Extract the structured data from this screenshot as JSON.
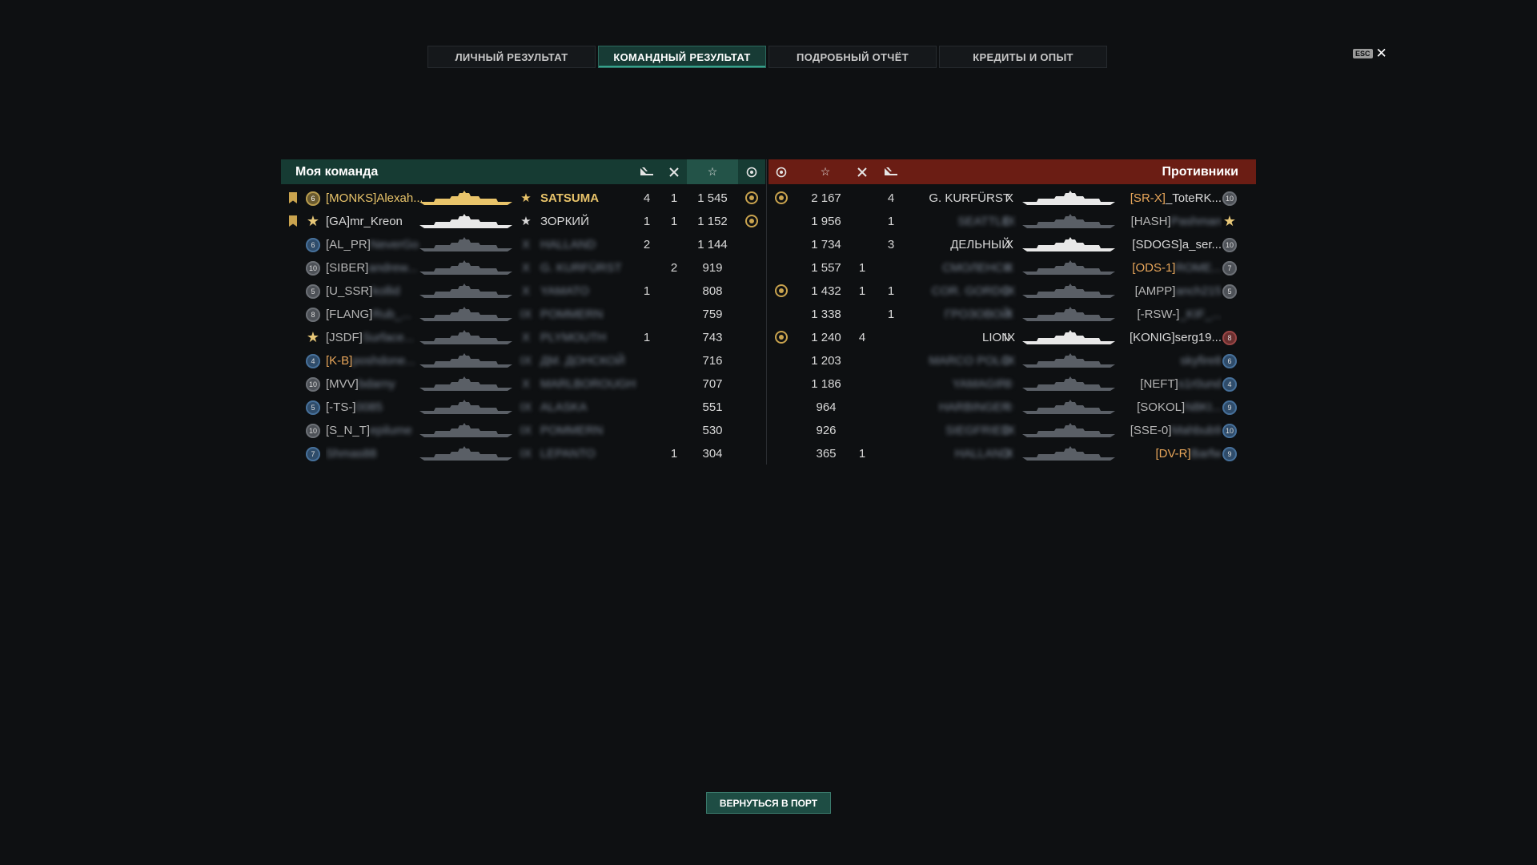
{
  "tabs": [
    {
      "label": "ЛИЧНЫЙ РЕЗУЛЬТАТ",
      "active": false
    },
    {
      "label": "КОМАНДНЫЙ РЕЗУЛЬТАТ",
      "active": true
    },
    {
      "label": "ПОДРОБНЫЙ ОТЧЁТ",
      "active": false
    },
    {
      "label": "КРЕДИТЫ И ОПЫТ",
      "active": false
    }
  ],
  "esc": {
    "key": "ESC",
    "close": "✕"
  },
  "my_team": {
    "title": "Моя команда",
    "header_icons": [
      "ship-sunk-icon",
      "planes-destroyed-icon",
      "base-xp-star-icon",
      "capture-icon"
    ],
    "rows": [
      {
        "tier": "6",
        "badge": "tier",
        "division": true,
        "clan": "[MONKS]",
        "name": "Alexah...",
        "tier_roman": "★",
        "ship": "SATSUMA",
        "kills": "4",
        "planes": "1",
        "xp": "1 545",
        "medal": true,
        "style": "gold"
      },
      {
        "tier": "★",
        "badge": "star",
        "division": true,
        "clan": "[GA]",
        "name": "mr_Kreon",
        "tier_roman": "★",
        "ship": "ЗОРКИЙ",
        "kills": "1",
        "planes": "1",
        "xp": "1 152",
        "medal": true,
        "style": "normal"
      },
      {
        "tier": "6",
        "badge": "blue",
        "division": false,
        "clan": "[AL_PR]",
        "name": "NeverGo",
        "tier_roman": "X",
        "ship": "HALLAND",
        "kills": "2",
        "planes": "",
        "xp": "1 144",
        "medal": false,
        "style": "dead"
      },
      {
        "tier": "10",
        "badge": "tier",
        "division": false,
        "clan": "[SIBER]",
        "name": "andrew...",
        "tier_roman": "X",
        "ship": "G. KURFÜRST",
        "kills": "",
        "planes": "2",
        "xp": "919",
        "medal": false,
        "style": "dead"
      },
      {
        "tier": "5",
        "badge": "tier",
        "division": false,
        "clan": "[U_SSR]",
        "name": "kollid",
        "tier_roman": "X",
        "ship": "YAMATO",
        "kills": "1",
        "planes": "",
        "xp": "808",
        "medal": false,
        "style": "dead"
      },
      {
        "tier": "8",
        "badge": "tier",
        "division": false,
        "clan": "[FLANG]",
        "name": "Rub_...",
        "tier_roman": "IX",
        "ship": "POMMERN",
        "kills": "",
        "planes": "",
        "xp": "759",
        "medal": false,
        "style": "dead"
      },
      {
        "tier": "★",
        "badge": "star",
        "division": false,
        "clan": "[JSDF]",
        "name": "Surface...",
        "tier_roman": "X",
        "ship": "PLYMOUTH",
        "kills": "1",
        "planes": "",
        "xp": "743",
        "medal": false,
        "style": "dead"
      },
      {
        "tier": "4",
        "badge": "blue",
        "division": false,
        "clan": "[K-B]",
        "name": "poshdone...",
        "tier_roman": "IX",
        "ship": "ДМ. ДОНСКОЙ",
        "kills": "",
        "planes": "",
        "xp": "716",
        "medal": false,
        "style": "dead-orange"
      },
      {
        "tier": "10",
        "badge": "tier",
        "division": false,
        "clan": "[MVV]",
        "name": "bdarny",
        "tier_roman": "X",
        "ship": "MARLBOROUGH",
        "kills": "",
        "planes": "",
        "xp": "707",
        "medal": false,
        "style": "dead"
      },
      {
        "tier": "5",
        "badge": "blue",
        "division": false,
        "clan": "[-TS-]",
        "name": "0085",
        "tier_roman": "IX",
        "ship": "ALASKA",
        "kills": "",
        "planes": "",
        "xp": "551",
        "medal": false,
        "style": "dead"
      },
      {
        "tier": "10",
        "badge": "tier",
        "division": false,
        "clan": "[S_N_T]",
        "name": "epilume",
        "tier_roman": "IX",
        "ship": "POMMERN",
        "kills": "",
        "planes": "",
        "xp": "530",
        "medal": false,
        "style": "dead"
      },
      {
        "tier": "7",
        "badge": "blue",
        "division": false,
        "clan": "",
        "name": "Shmas88",
        "tier_roman": "IX",
        "ship": "LEPANTO",
        "kills": "",
        "planes": "1",
        "xp": "304",
        "medal": false,
        "style": "dead"
      }
    ]
  },
  "enemy_team": {
    "title": "Противники",
    "header_icons": [
      "capture-icon",
      "base-xp-star-icon",
      "planes-destroyed-icon",
      "ship-sunk-icon"
    ],
    "rows": [
      {
        "medal": true,
        "xp": "2 167",
        "planes": "",
        "kills": "4",
        "ship": "G. KURFÜRST",
        "tier_roman": "X",
        "clan": "[SR-X]",
        "name": "_ToteRK...",
        "tier": "10",
        "badge": "tier",
        "style": "alive-orange"
      },
      {
        "medal": false,
        "xp": "1 956",
        "planes": "",
        "kills": "1",
        "ship": "SEATTLE",
        "tier_roman": "IX",
        "clan": "[HASH]",
        "name": "Pashman",
        "tier": "★",
        "badge": "star",
        "style": "dead"
      },
      {
        "medal": false,
        "xp": "1 734",
        "planes": "",
        "kills": "3",
        "ship": "ДЕЛЬНЫЙ",
        "tier_roman": "X",
        "clan": "[SDOGS]",
        "name": "a_ser...",
        "tier": "10",
        "badge": "tier",
        "style": "normal"
      },
      {
        "medal": false,
        "xp": "1 557",
        "planes": "1",
        "kills": "",
        "ship": "СМОЛЕНСК",
        "tier_roman": "X",
        "clan": "[ODS-1]",
        "name": "ROME...",
        "tier": "7",
        "badge": "tier",
        "style": "dead-orange"
      },
      {
        "medal": true,
        "xp": "1 432",
        "planes": "1",
        "kills": "1",
        "ship": "COR. GORDO",
        "tier_roman": "IX",
        "clan": "[AMPP]",
        "name": "anch215",
        "tier": "5",
        "badge": "tier",
        "style": "dead"
      },
      {
        "medal": false,
        "xp": "1 338",
        "planes": "",
        "kills": "1",
        "ship": "ГРОЗОВОЙ",
        "tier_roman": "X",
        "clan": "[-RSW-]",
        "name": "_KIF_...",
        "tier": "",
        "badge": "none",
        "style": "dead"
      },
      {
        "medal": true,
        "xp": "1 240",
        "planes": "4",
        "kills": "",
        "ship": "LION",
        "tier_roman": "IX",
        "clan": "[KONIG]",
        "name": "serg19...",
        "tier": "8",
        "badge": "red",
        "style": "normal"
      },
      {
        "medal": false,
        "xp": "1 203",
        "planes": "",
        "kills": "",
        "ship": "MARCO POLO",
        "tier_roman": "IX",
        "clan": "",
        "name": "skyfire8",
        "tier": "6",
        "badge": "blue",
        "style": "dead"
      },
      {
        "medal": false,
        "xp": "1 186",
        "planes": "",
        "kills": "",
        "ship": "YAMAGIRI",
        "tier_roman": "☆",
        "clan": "[NEFT]",
        "name": "s1r0und",
        "tier": "4",
        "badge": "blue",
        "style": "dead"
      },
      {
        "medal": false,
        "xp": "964",
        "planes": "",
        "kills": "",
        "ship": "HARBINGER",
        "tier_roman": "☆",
        "clan": "[SOKOL]",
        "name": "N8KI...",
        "tier": "9",
        "badge": "blue",
        "style": "dead"
      },
      {
        "medal": false,
        "xp": "926",
        "planes": "",
        "kills": "",
        "ship": "SIEGFRIED",
        "tier_roman": "IX",
        "clan": "[SSE-0]",
        "name": "Mahbub9",
        "tier": "10",
        "badge": "blue",
        "style": "dead"
      },
      {
        "medal": false,
        "xp": "365",
        "planes": "1",
        "kills": "",
        "ship": "HALLAND",
        "tier_roman": "X",
        "clan": "[DV-R]",
        "name": "Barfw",
        "tier": "9",
        "badge": "blue",
        "style": "dead-orange"
      }
    ]
  },
  "footer": {
    "port_button": "ВЕРНУТЬСЯ В ПОРТ"
  },
  "colors": {
    "my_team": "#163b33",
    "enemy_team": "#6b1d14",
    "gold": "#e9c46a",
    "accent": "#35a08a"
  }
}
